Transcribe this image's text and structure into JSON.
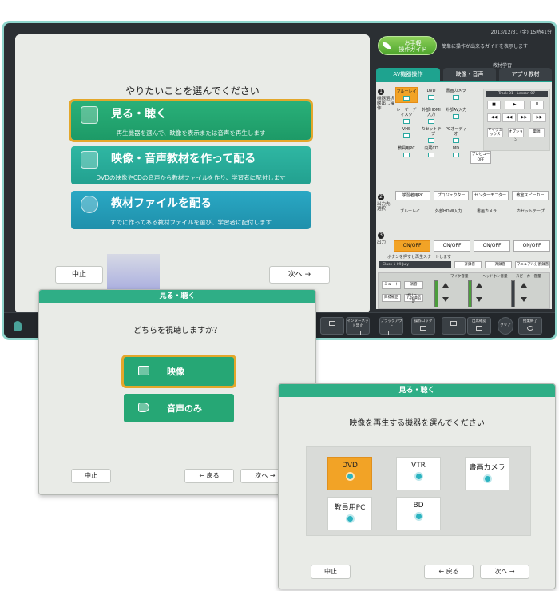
{
  "colors": {
    "accent_green": "#29b079",
    "accent_teal": "#2fb7a3",
    "accent_blue": "#2aa8c4",
    "highlight_orange": "#f2a326",
    "frame_mint": "#8fd5cc"
  },
  "main": {
    "prompt": "やりたいことを選んでください",
    "buttons": [
      {
        "title": "見る・聴く",
        "desc": "再生機器を選んで、映像を表示または音声を再生します",
        "icon": "monitor-icon"
      },
      {
        "title": "映像・音声教材を作って配る",
        "desc": "DVDの映像やCDの音声から教材ファイルを作り、学習者に配付します",
        "icon": "copy-icon"
      },
      {
        "title": "教材ファイルを配る",
        "desc": "すでに作ってある教材ファイルを選び、学習者に配付します",
        "icon": "disc-icon"
      }
    ],
    "cancel": "中止",
    "next": "次へ"
  },
  "console": {
    "date": "2013/12/31 (金) 15時41分",
    "guide_label": "お手軽\n操作ガイド",
    "guide_desc": "簡単に操作が出来るガイドを表示します",
    "edu_label": "教材学習",
    "tabs": [
      "AV機器操作",
      "映像・音声",
      "アプリ教材"
    ],
    "step1_label": "機器選択\n映出し操作",
    "devices": [
      "ブルーレイ",
      "DVD",
      "書画カメラ",
      "レーザーディスク",
      "外部HDMI入力",
      "外部AV入力",
      "VHS",
      "カセットテープ",
      "PCオーディオ",
      "教員用PC",
      "内蔵CD",
      "MD"
    ],
    "preview": "プレビューOFF",
    "track": "Track 01 - Lesson 07",
    "player_buttons": [
      "■",
      "▶",
      "II",
      "◀◀",
      "◀◀",
      "▶▶",
      "▶▶"
    ],
    "player_extra": [
      "マイクミックス",
      "オプション",
      "電源"
    ],
    "step2_label": "出力先\n選択",
    "outputs": [
      "学習者用PC",
      "プロジェクター",
      "センターモニター",
      "教室スピーカー"
    ],
    "sub_devices": [
      "ブルーレイ",
      "外部HDMI入力",
      "書画カメラ",
      "カセットテープ"
    ],
    "step3_label": "出力",
    "onoff": "ON/OFF",
    "prompt_note": "ボタンを押すと再生スタートします",
    "class_bar": "Class-1 09.July",
    "record": [
      "一斉録音",
      "一斉録音",
      "マニュアル分割録音"
    ],
    "mixer_labels": [
      "マイク音量",
      "ヘッドホン音量",
      "スピーカー音量"
    ],
    "mixer_buttons": [
      "ミュート",
      "消音",
      "目標補正",
      "ボリューム詳細設定"
    ],
    "slider_value": "30",
    "toolbar": [
      "インターネット禁止",
      "ブラックアウト",
      "操作ロック",
      "出席確認",
      "クリア",
      "授業終了"
    ]
  },
  "dialog2": {
    "title": "見る・聴く",
    "prompt": "どちらを視聴しますか？",
    "choices": [
      "映像",
      "音声のみ"
    ],
    "cancel": "中止",
    "back": "戻る",
    "next": "次へ"
  },
  "dialog3": {
    "title": "見る・聴く",
    "prompt": "映像を再生する機器を選んでください",
    "devices": [
      "DVD",
      "VTR",
      "書画カメラ",
      "教員用PC",
      "BD"
    ],
    "cancel": "中止",
    "back": "戻る",
    "next": "次へ"
  }
}
